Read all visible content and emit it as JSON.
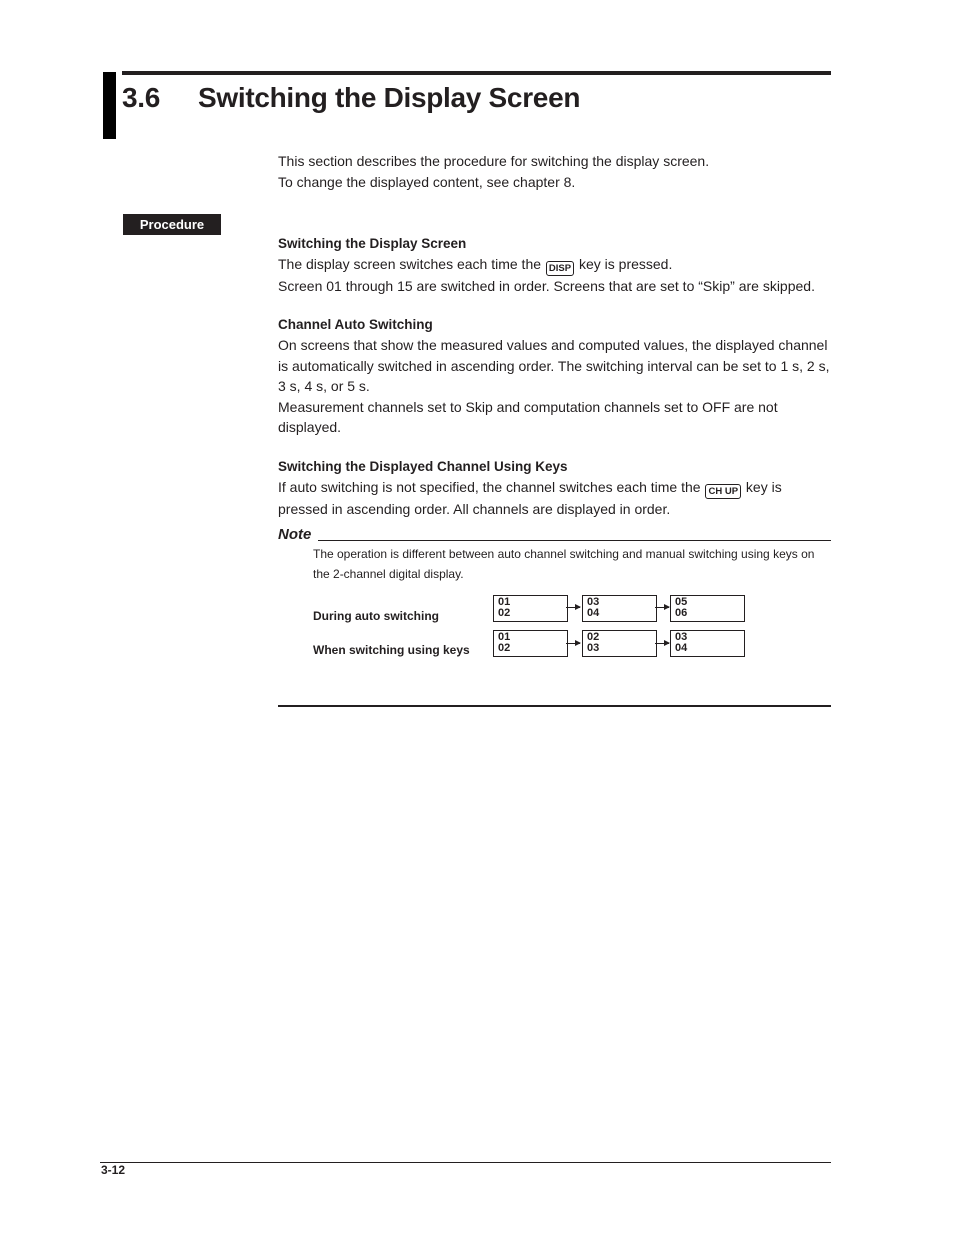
{
  "header": {
    "section_number": "3.6",
    "section_title": "Switching the Display Screen"
  },
  "intro": [
    "This section describes the procedure for switching the display screen.",
    "To change the displayed content, see chapter 8."
  ],
  "procedure_tag": "Procedure",
  "subsections": {
    "display_screen": {
      "heading": "Switching the Display Screen",
      "line1_before": "The display screen switches each time the",
      "key": "DISP",
      "line1_after": "key is pressed.",
      "line2": "Screen 01 through 15 are switched in order.  Screens that are set to “Skip” are skipped."
    },
    "auto_switching": {
      "heading": "Channel Auto Switching",
      "para1": "On screens that show the measured values and computed values, the displayed channel is automatically switched in ascending order.  The switching interval can be set to 1 s, 2 s, 3 s, 4 s, or 5 s.",
      "para2": "Measurement channels set to Skip and computation channels set to OFF are not displayed."
    },
    "keys_switching": {
      "heading": "Switching the Displayed Channel Using Keys",
      "text_before": "If auto switching is not specified, the channel switches each time the",
      "key": "CH UP",
      "text_after": "key is pressed in ascending order.  All channels are displayed in order."
    }
  },
  "note": {
    "label": "Note",
    "text": "The operation is different between auto channel switching and manual switching using keys on the 2-channel digital display.",
    "rows": [
      {
        "label": "During auto switching",
        "screens": [
          [
            "01",
            "02"
          ],
          [
            "03",
            "04"
          ],
          [
            "05",
            "06"
          ]
        ]
      },
      {
        "label": "When switching using keys",
        "screens": [
          [
            "01",
            "02"
          ],
          [
            "02",
            "03"
          ],
          [
            "03",
            "04"
          ]
        ]
      }
    ]
  },
  "footer": {
    "page_number": "3-12"
  }
}
